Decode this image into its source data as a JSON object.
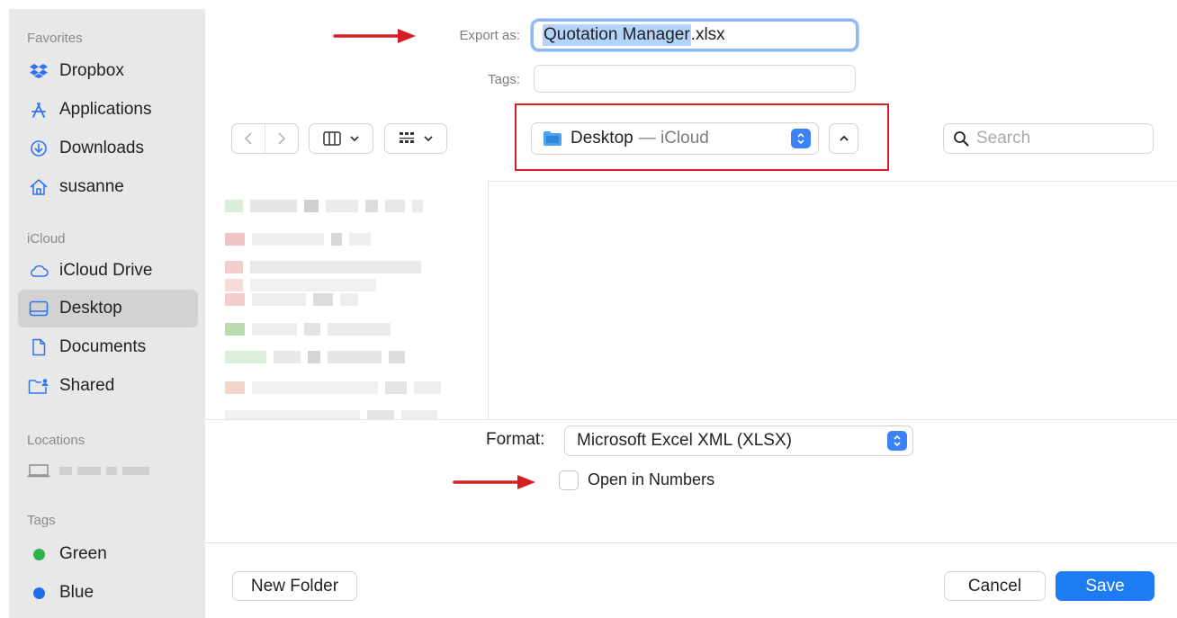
{
  "sidebar": {
    "favorites_header": "Favorites",
    "favorites": [
      {
        "label": "Dropbox",
        "icon": "dropbox-icon"
      },
      {
        "label": "Applications",
        "icon": "applications-icon"
      },
      {
        "label": "Downloads",
        "icon": "downloads-icon"
      },
      {
        "label": "susanne",
        "icon": "home-icon"
      }
    ],
    "icloud_header": "iCloud",
    "icloud": [
      {
        "label": "iCloud Drive",
        "icon": "cloud-icon"
      },
      {
        "label": "Desktop",
        "icon": "desktop-icon",
        "selected": true
      },
      {
        "label": "Documents",
        "icon": "document-icon"
      },
      {
        "label": "Shared",
        "icon": "shared-folder-icon"
      }
    ],
    "locations_header": "Locations",
    "tags_header": "Tags",
    "tags": [
      {
        "label": "Green",
        "color": "#2fb34a"
      },
      {
        "label": "Blue",
        "color": "#1f6ff0"
      }
    ]
  },
  "export": {
    "label": "Export as:",
    "filename_selected": "Quotation Manager",
    "filename_ext": ".xlsx"
  },
  "tags_field": {
    "label": "Tags:",
    "value": ""
  },
  "toolbar": {
    "location_name": "Desktop",
    "location_sub": "— iCloud",
    "search_placeholder": "Search"
  },
  "format": {
    "label": "Format:",
    "value": "Microsoft Excel XML (XLSX)"
  },
  "open_in_numbers": {
    "label": "Open in Numbers",
    "checked": false
  },
  "buttons": {
    "new_folder": "New Folder",
    "cancel": "Cancel",
    "save": "Save"
  },
  "colors": {
    "accent": "#1d7cf2",
    "annotation_red": "#d51f24"
  }
}
